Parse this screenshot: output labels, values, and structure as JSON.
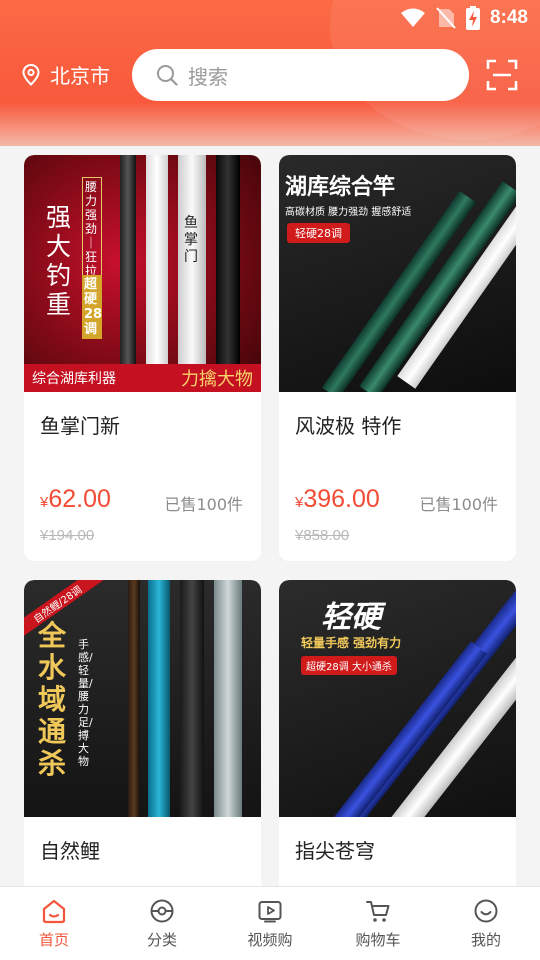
{
  "status_bar": {
    "time": "8:48"
  },
  "header": {
    "location": "北京市",
    "search_placeholder": "搜索"
  },
  "products": [
    {
      "name": "鱼掌门新",
      "price_currency": "¥",
      "price": "62.00",
      "sold": "已售100件",
      "original_price": "¥194.00",
      "image_text": {
        "big": "强大钓重",
        "side": "腰力强劲｜狂拉不断",
        "tag": "超硬28调",
        "band_left": "综合湖库利器",
        "band_right": "力擒大物",
        "rod_label": "鱼掌门"
      }
    },
    {
      "name": "风波极 特作",
      "price_currency": "¥",
      "price": "396.00",
      "sold": "已售100件",
      "original_price": "¥858.00",
      "image_text": {
        "title": "湖库综合竿",
        "sub": "高碳材质 腰力强劲 握感舒适",
        "tag": "轻硬28调"
      }
    },
    {
      "name": "自然鲤",
      "image_text": {
        "corner": "自然鲤/28调",
        "big": "全水域通杀",
        "sub": "手感/轻量/腰力足/搏大物"
      }
    },
    {
      "name": "指尖苍穹",
      "image_text": {
        "title": "轻硬",
        "sub": "轻量手感 强劲有力",
        "tag": "超硬28调 大小通杀"
      }
    }
  ],
  "tabs": [
    {
      "label": "首页",
      "icon": "home-icon",
      "active": true
    },
    {
      "label": "分类",
      "icon": "category-icon",
      "active": false
    },
    {
      "label": "视频购",
      "icon": "video-icon",
      "active": false
    },
    {
      "label": "购物车",
      "icon": "cart-icon",
      "active": false
    },
    {
      "label": "我的",
      "icon": "profile-icon",
      "active": false
    }
  ],
  "colors": {
    "accent": "#f4563b",
    "header": "#fb6a45",
    "price": "#f24c35"
  }
}
